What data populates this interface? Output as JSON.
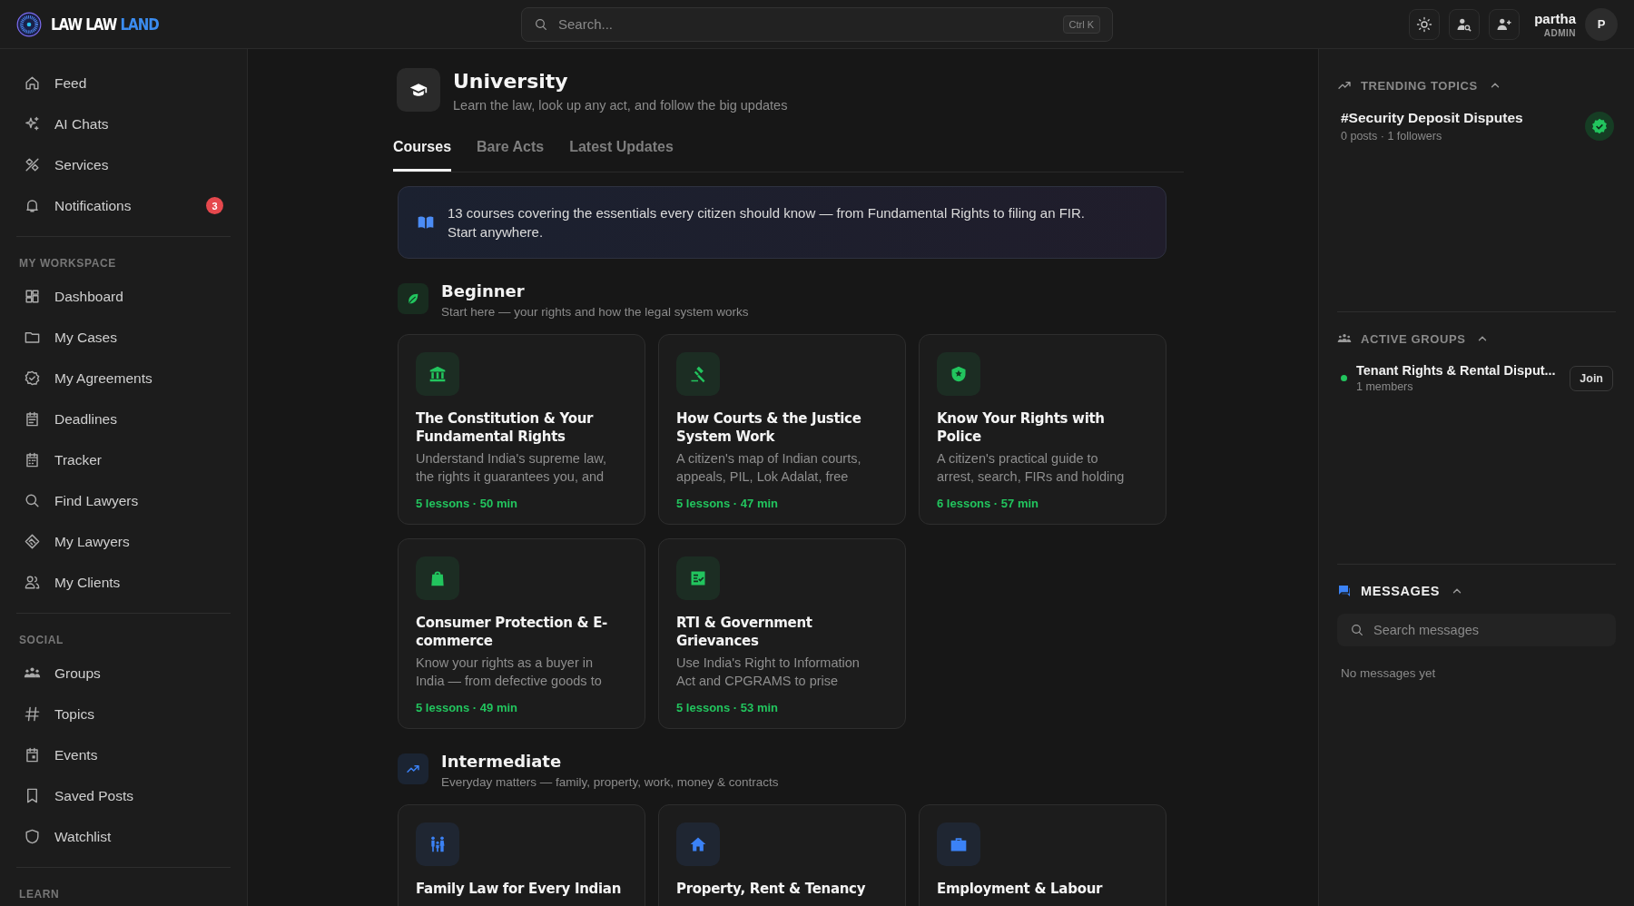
{
  "brand": {
    "name": "LAW LAW",
    "accent": "LAND"
  },
  "search": {
    "placeholder": "Search...",
    "shortcut": "Ctrl K"
  },
  "user": {
    "name": "partha",
    "role": "ADMIN",
    "initial": "P"
  },
  "sidebar": {
    "sections": [
      {
        "items": [
          {
            "label": "Feed",
            "selected": false
          },
          {
            "label": "AI Chats",
            "selected": false
          },
          {
            "label": "Services",
            "selected": false
          },
          {
            "label": "Notifications",
            "selected": false,
            "badge": "3"
          }
        ]
      },
      {
        "heading": "MY WORKSPACE",
        "items": [
          {
            "label": "Dashboard",
            "selected": false
          },
          {
            "label": "My Cases",
            "selected": false
          },
          {
            "label": "My Agreements",
            "selected": false
          },
          {
            "label": "Deadlines",
            "selected": false
          },
          {
            "label": "Tracker",
            "selected": false
          },
          {
            "label": "Find Lawyers",
            "selected": false
          },
          {
            "label": "My Lawyers",
            "selected": false
          },
          {
            "label": "My Clients",
            "selected": false
          }
        ]
      },
      {
        "heading": "SOCIAL",
        "items": [
          {
            "label": "Groups",
            "selected": false
          },
          {
            "label": "Topics",
            "selected": false
          },
          {
            "label": "Events",
            "selected": false
          },
          {
            "label": "Saved Posts",
            "selected": false
          },
          {
            "label": "Watchlist",
            "selected": false
          }
        ]
      },
      {
        "heading": "LEARN"
      }
    ]
  },
  "page": {
    "title": "University",
    "subtitle": "Learn the law, look up any act, and follow the big updates"
  },
  "tabs": [
    {
      "label": "Courses",
      "selected": true
    },
    {
      "label": "Bare Acts",
      "selected": false
    },
    {
      "label": "Latest Updates",
      "selected": false
    }
  ],
  "banner": "13 courses covering the essentials every citizen should know — from Fundamental Rights to filing an FIR. Start anywhere.",
  "levels": [
    {
      "title": "Beginner",
      "subtitle": "Start here — your rights and how the legal system works",
      "color": "#22c55e",
      "courses": [
        {
          "title": "The Constitution & Your Fundamental Rights",
          "description": "Understand India's supreme law, the rights it guarantees you, and",
          "meta": "5 lessons · 50 min"
        },
        {
          "title": "How Courts & the Justice System Work",
          "description": "A citizen's map of Indian courts, appeals, PIL, Lok Adalat, free",
          "meta": "5 lessons · 47 min"
        },
        {
          "title": "Know Your Rights with Police",
          "description": "A citizen's practical guide to arrest, search, FIRs and holding",
          "meta": "6 lessons · 57 min"
        },
        {
          "title": "Consumer Protection & E-commerce",
          "description": "Know your rights as a buyer in India — from defective goods to",
          "meta": "5 lessons · 49 min"
        },
        {
          "title": "RTI & Government Grievances",
          "description": "Use India's Right to Information Act and CPGRAMS to prise",
          "meta": "5 lessons · 53 min"
        }
      ]
    },
    {
      "title": "Intermediate",
      "subtitle": "Everyday matters — family, property, work, money & contracts",
      "color": "#3b82f6",
      "courses": [
        {
          "title": "Family Law for Every Indian"
        },
        {
          "title": "Property, Rent & Tenancy"
        },
        {
          "title": "Employment & Labour"
        }
      ]
    }
  ],
  "trending": {
    "heading": "TRENDING TOPICS",
    "expanded": true,
    "topics": [
      {
        "title": "#Security Deposit Disputes",
        "stats": "0 posts · 1 followers",
        "following": true
      }
    ]
  },
  "groups": {
    "heading": "ACTIVE GROUPS",
    "expanded": true,
    "items": [
      {
        "name": "Tenant Rights & Rental Disput...",
        "members": "1 members",
        "color": "#22c55e",
        "action": "Join"
      }
    ]
  },
  "messages": {
    "heading": "MESSAGES",
    "expanded": true,
    "placeholder": "Search messages",
    "empty": "No messages yet"
  }
}
